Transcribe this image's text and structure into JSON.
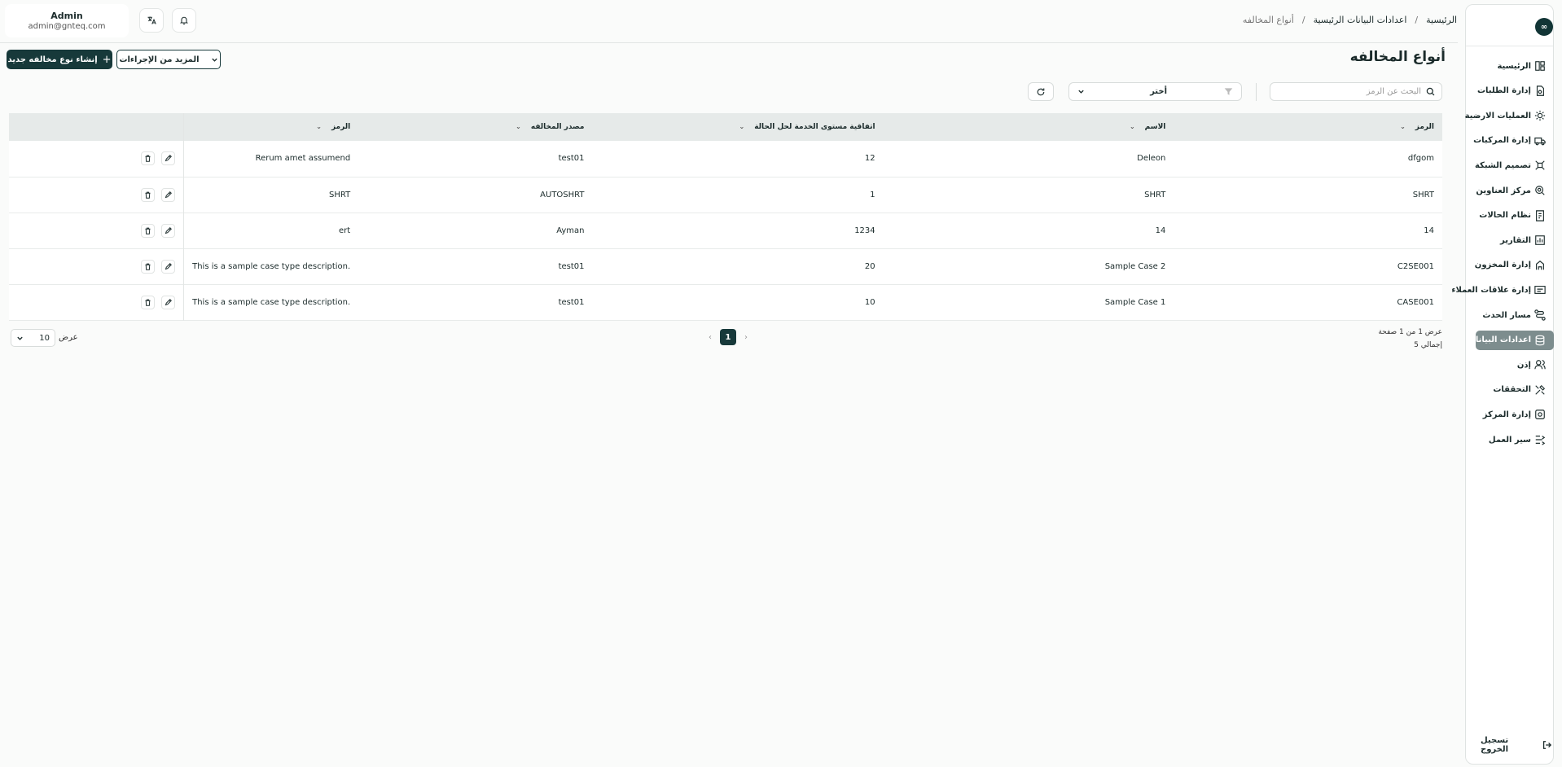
{
  "sidebar": {
    "items": [
      {
        "label": "الرئيسية",
        "icon": "dashboard-icon"
      },
      {
        "label": "إدارة الطلبات",
        "icon": "orders-icon"
      },
      {
        "label": "العمليات الارضية",
        "icon": "ground-ops-icon"
      },
      {
        "label": "إدارة المركبات",
        "icon": "truck-icon"
      },
      {
        "label": "تصميم الشبكة",
        "icon": "network-icon"
      },
      {
        "label": "مركز العناوين",
        "icon": "location-icon"
      },
      {
        "label": "نظام الحالات",
        "icon": "cases-icon"
      },
      {
        "label": "التقارير",
        "icon": "reports-icon"
      },
      {
        "label": "إدارة المخزون",
        "icon": "inventory-icon"
      },
      {
        "label": "إدارة علاقات العملاء",
        "icon": "crm-icon"
      },
      {
        "label": "مسار الحدث",
        "icon": "route-icon"
      },
      {
        "label": "اعدادات البيانات",
        "icon": "database-icon"
      },
      {
        "label": "إذن",
        "icon": "users-icon"
      },
      {
        "label": "التحققات",
        "icon": "tools-icon"
      },
      {
        "label": "إدارة المركز",
        "icon": "hub-icon"
      },
      {
        "label": "سير العمل",
        "icon": "workflow-icon"
      }
    ],
    "active_index": 11,
    "logout_label": "تسجيل الخروج"
  },
  "header": {
    "user_name": "Admin",
    "user_email": "admin@gnteq.com",
    "breadcrumb": [
      "الرئيسية",
      "اعدادات البيانات الرئيسية",
      "أنواع المخالفه"
    ],
    "breadcrumb_sep": "/"
  },
  "page": {
    "title": "أنواع المخالفه",
    "create_button": "إنشاء نوع مخالفه جديد",
    "more_actions_button": "المزيد من الإجراءات",
    "search_placeholder": "البحث عن الرمز",
    "filter_label": "أختر"
  },
  "table": {
    "columns": [
      "الرمز",
      "الاسم",
      "اتفاقية مستوى الخدمة لحل الحالة",
      "مصدر المخالفه",
      "الرمز"
    ],
    "rows": [
      [
        "dfgom",
        "Deleon",
        "12",
        "test01",
        "Rerum amet assumend"
      ],
      [
        "SHRT",
        "SHRT",
        "1",
        "AUTOSHRT",
        "SHRT"
      ],
      [
        "14",
        "14",
        "1234",
        "Ayman",
        "ert"
      ],
      [
        "C2SE001",
        "Sample Case 2",
        "20",
        "test01",
        "This is a sample case type description."
      ],
      [
        "CASE001",
        "Sample Case 1",
        "10",
        "test01",
        "This is a sample case type description."
      ]
    ]
  },
  "pagination": {
    "info_line1": "عرض 1 من 1 صفحة",
    "info_line2": "إجمالي 5",
    "current_page": "1",
    "per_page_label": "عرض",
    "per_page_value": "10"
  },
  "colors": {
    "primary": "#17393a",
    "active_nav": "#7d8d8e"
  }
}
